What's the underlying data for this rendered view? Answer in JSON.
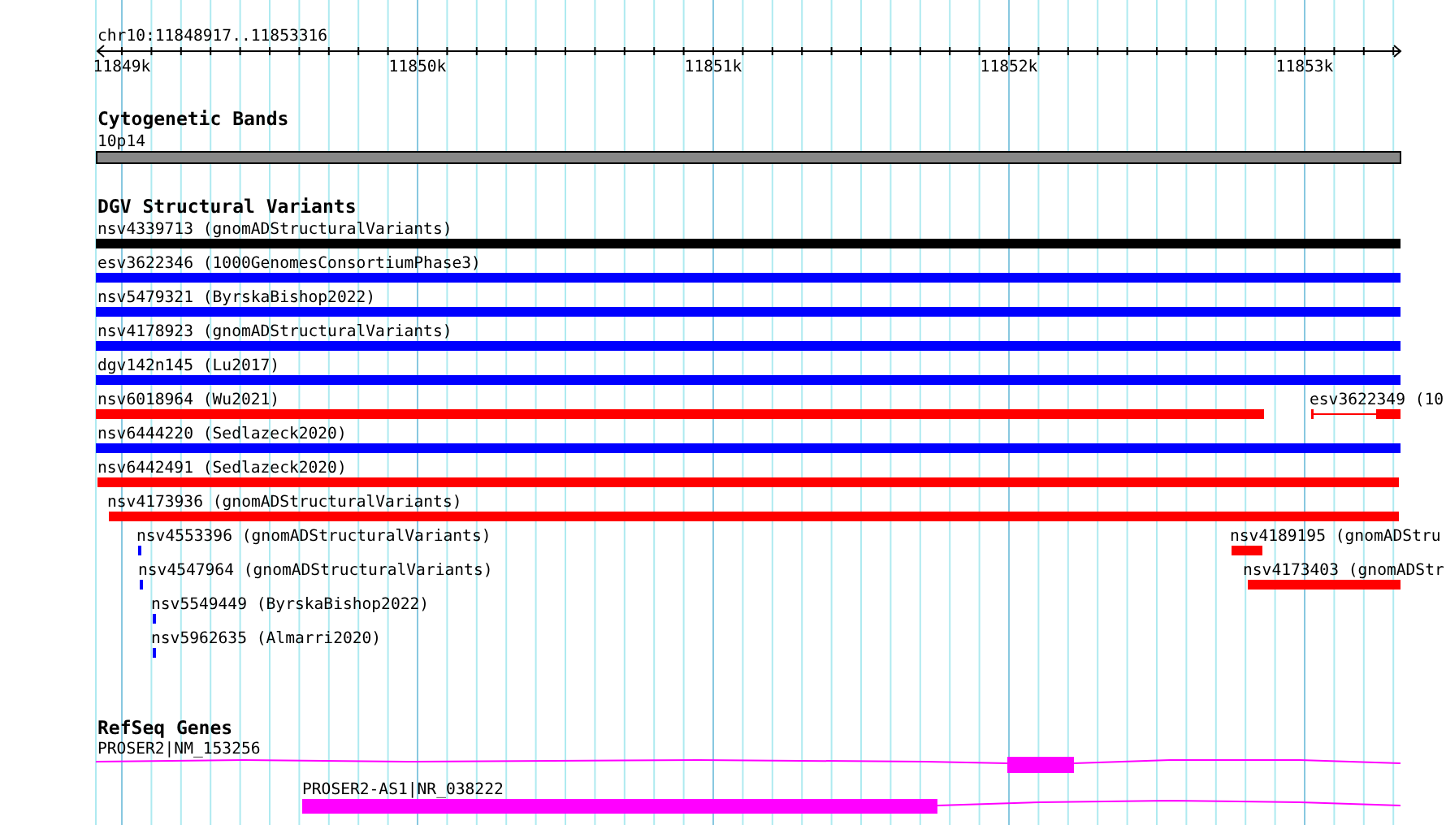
{
  "ruler": {
    "location": "chr10:11848917..11853316",
    "ticks": [
      "11849k",
      "11850k",
      "11851k",
      "11852k",
      "11853k"
    ]
  },
  "tracks": [
    {
      "kind": "bands",
      "title": "Cytogenetic Bands",
      "features": [
        {
          "label": "10p14"
        }
      ]
    },
    {
      "kind": "variants",
      "title": "DGV Structural Variants",
      "features": [
        {
          "label": "nsv4339713 (gnomADStructuralVariants)",
          "color": "#000000"
        },
        {
          "label": "esv3622346 (1000GenomesConsortiumPhase3)",
          "color": "#0000ff"
        },
        {
          "label": "nsv5479321 (ByrskaBishop2022)",
          "color": "#0000ff"
        },
        {
          "label": "nsv4178923 (gnomADStructuralVariants)",
          "color": "#0000ff"
        },
        {
          "label": "dgv142n145 (Lu2017)",
          "color": "#0000ff"
        },
        {
          "label": "nsv6018964 (Wu2021)",
          "color": "#ff0000"
        },
        {
          "label": "esv3622349 (10",
          "color": "#ff0000"
        },
        {
          "label": "nsv6444220 (Sedlazeck2020)",
          "color": "#0000ff"
        },
        {
          "label": "nsv6442491 (Sedlazeck2020)",
          "color": "#ff0000"
        },
        {
          "label": "nsv4173936 (gnomADStructuralVariants)",
          "color": "#ff0000"
        },
        {
          "label": "nsv4553396 (gnomADStructuralVariants)",
          "color": "#0000ff"
        },
        {
          "label": "nsv4189195 (gnomADStru",
          "color": "#ff0000"
        },
        {
          "label": "nsv4547964 (gnomADStructuralVariants)",
          "color": "#0000ff"
        },
        {
          "label": "nsv4173403 (gnomADStr",
          "color": "#ff0000"
        },
        {
          "label": "nsv5549449 (ByrskaBishop2022)",
          "color": "#0000ff"
        },
        {
          "label": "nsv5962635 (Almarri2020)",
          "color": "#0000ff"
        }
      ]
    },
    {
      "kind": "genes",
      "title": "RefSeq Genes",
      "features": [
        {
          "label": "PROSER2|NM_153256"
        },
        {
          "label": "PROSER2-AS1|NR_038222"
        }
      ]
    }
  ]
}
